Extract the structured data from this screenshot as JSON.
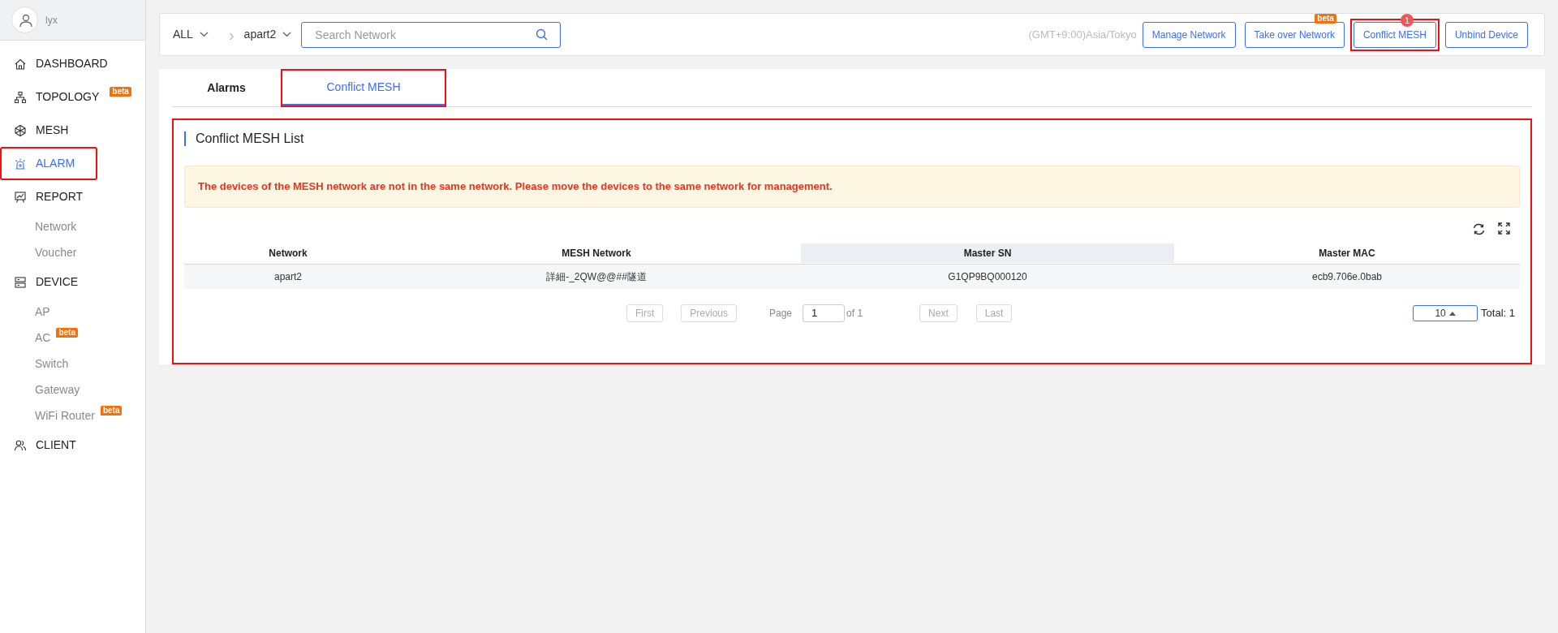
{
  "user": {
    "name": "lyx"
  },
  "sidebar": {
    "items": [
      {
        "kind": "main",
        "label": "DASHBOARD",
        "selected": false,
        "highlighted": false
      },
      {
        "kind": "main",
        "label": "TOPOLOGY",
        "selected": false,
        "highlighted": false,
        "badge": "beta"
      },
      {
        "kind": "main",
        "label": "MESH",
        "selected": false,
        "highlighted": false
      },
      {
        "kind": "main",
        "label": "ALARM",
        "selected": true,
        "highlighted": true
      },
      {
        "kind": "main",
        "label": "REPORT",
        "selected": false,
        "highlighted": false
      },
      {
        "kind": "sub",
        "label": "Network",
        "selected": false,
        "highlighted": false
      },
      {
        "kind": "sub",
        "label": "Voucher",
        "selected": false,
        "highlighted": false
      },
      {
        "kind": "main",
        "label": "DEVICE",
        "selected": false,
        "highlighted": false
      },
      {
        "kind": "sub",
        "label": "AP",
        "selected": false,
        "highlighted": false
      },
      {
        "kind": "sub",
        "label": "AC",
        "selected": false,
        "highlighted": false,
        "badge": "beta"
      },
      {
        "kind": "sub",
        "label": "Switch",
        "selected": false,
        "highlighted": false
      },
      {
        "kind": "sub",
        "label": "Gateway",
        "selected": false,
        "highlighted": false
      },
      {
        "kind": "sub",
        "label": "WiFi Router",
        "selected": false,
        "highlighted": false,
        "badge": "beta"
      },
      {
        "kind": "main",
        "label": "CLIENT",
        "selected": false,
        "highlighted": false
      }
    ]
  },
  "topbar": {
    "group_select": "ALL",
    "separator": "›",
    "network_select": "apart2",
    "search": {
      "placeholder": "Search Network"
    },
    "timezone": "(GMT+9:00)Asia/Tokyo",
    "buttons": [
      {
        "label": "Manage Network",
        "highlighted": false
      },
      {
        "label": "Take over Network",
        "highlighted": false,
        "badge": "beta"
      },
      {
        "label": "Conflict MESH",
        "highlighted": true,
        "count": "1"
      },
      {
        "label": "Unbind Device",
        "highlighted": false
      }
    ]
  },
  "tabs": [
    {
      "label": "Alarms",
      "selected": false,
      "highlighted": false
    },
    {
      "label": "Conflict MESH",
      "selected": true,
      "highlighted": true
    }
  ],
  "panel": {
    "title": "Conflict MESH List",
    "highlighted": true,
    "alert": "The devices of the MESH network are not in the same network. Please move the devices to the same network for management.",
    "table": {
      "columns": [
        {
          "label": "Network",
          "selected": false
        },
        {
          "label": "MESH Network",
          "selected": false
        },
        {
          "label": "Master SN",
          "selected": true
        },
        {
          "label": "Master MAC",
          "selected": false
        }
      ],
      "rows": [
        [
          "apart2",
          "詳細-_2QW@@##隧道",
          "G1QP9BQ000120",
          "ecb9.706e.0bab"
        ]
      ]
    },
    "pagination": {
      "first": "First",
      "previous": "Previous",
      "page_label": "Page",
      "page": "1",
      "of": "of 1",
      "next": "Next",
      "last": "Last",
      "page_size": "10",
      "total": "Total: 1"
    }
  }
}
